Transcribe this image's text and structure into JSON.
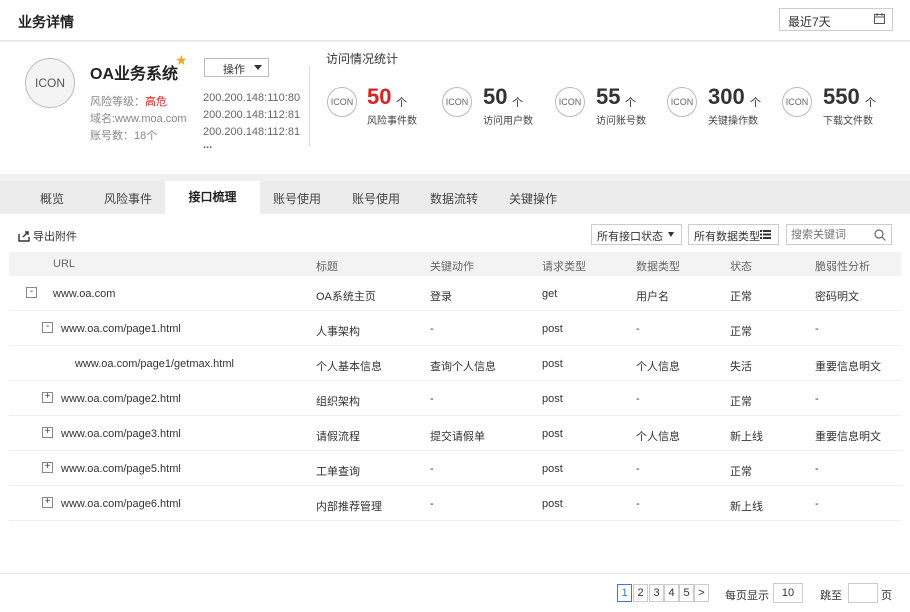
{
  "header": {
    "title": "业务详情",
    "date_range": "最近7天"
  },
  "system": {
    "icon_label": "ICON",
    "name": "OA业务系统",
    "risk_label": "风险等级：",
    "risk_value": "高危",
    "domain": "域名:www.moa.com",
    "accounts": "账号数：18个",
    "action_button": "操作",
    "ips": [
      "200.200.148:110:80",
      "200.200.148:112:81",
      "200.200.148:112:81"
    ],
    "ips_more": "..."
  },
  "stats": {
    "title": "访问情况统计",
    "unit": "个",
    "items": [
      {
        "icon": "ICON",
        "value": "50",
        "label": "风险事件数",
        "highlight": true
      },
      {
        "icon": "ICON",
        "value": "50",
        "label": "访问用户数",
        "highlight": false
      },
      {
        "icon": "ICON",
        "value": "55",
        "label": "访问账号数",
        "highlight": false
      },
      {
        "icon": "ICON",
        "value": "300",
        "label": "关键操作数",
        "highlight": false
      },
      {
        "icon": "ICON",
        "value": "550",
        "label": "下载文件数",
        "highlight": false
      }
    ]
  },
  "tabs": [
    "概览",
    "风险事件",
    "接口梳理",
    "账号使用",
    "账号使用",
    "数据流转",
    "关键操作"
  ],
  "active_tab": 2,
  "toolbar": {
    "export": "导出附件",
    "status_filter": "所有接口状态",
    "type_filter": "所有数据类型",
    "search_placeholder": "搜索关键词"
  },
  "table": {
    "columns": [
      "URL",
      "标题",
      "关键动作",
      "请求类型",
      "数据类型",
      "状态",
      "脆弱性分析"
    ],
    "rows": [
      {
        "toggle": "-",
        "level": 0,
        "url": "www.oa.com",
        "title": "OA系统主页",
        "action": "登录",
        "method": "get",
        "data_type": "用户名",
        "status": "正常",
        "vuln": "密码明文"
      },
      {
        "toggle": "-",
        "level": 1,
        "url": "www.oa.com/page1.html",
        "title": "人事架构",
        "action": "-",
        "method": "post",
        "data_type": "-",
        "status": "正常",
        "vuln": "-"
      },
      {
        "toggle": "",
        "level": 2,
        "url": "www.oa.com/page1/getmax.html",
        "title": "个人基本信息",
        "action": "查询个人信息",
        "method": "post",
        "data_type": "个人信息",
        "status": "失活",
        "vuln": "重要信息明文"
      },
      {
        "toggle": "+",
        "level": 1,
        "url": "www.oa.com/page2.html",
        "title": "组织架构",
        "action": "-",
        "method": "post",
        "data_type": "-",
        "status": "正常",
        "vuln": "-"
      },
      {
        "toggle": "+",
        "level": 1,
        "url": "www.oa.com/page3.html",
        "title": "请假流程",
        "action": "提交请假单",
        "method": "post",
        "data_type": "个人信息",
        "status": "新上线",
        "vuln": "重要信息明文"
      },
      {
        "toggle": "+",
        "level": 1,
        "url": "www.oa.com/page5.html",
        "title": "工单查询",
        "action": "-",
        "method": "post",
        "data_type": "-",
        "status": "正常",
        "vuln": "-"
      },
      {
        "toggle": "+",
        "level": 1,
        "url": "www.oa.com/page6.html",
        "title": "内部推荐管理",
        "action": "-",
        "method": "post",
        "data_type": "-",
        "status": "新上线",
        "vuln": "-"
      }
    ]
  },
  "pagination": {
    "pages": [
      "1",
      "2",
      "3",
      "4",
      "5"
    ],
    "current": "1",
    "next": ">",
    "per_page_label": "每页显示",
    "per_page": "10",
    "jump_label": "跳至",
    "jump_value": "",
    "page_suffix": "页"
  },
  "colors": {
    "accent": "#3a7bd5",
    "danger": "#e02020",
    "star": "#f5a623"
  }
}
